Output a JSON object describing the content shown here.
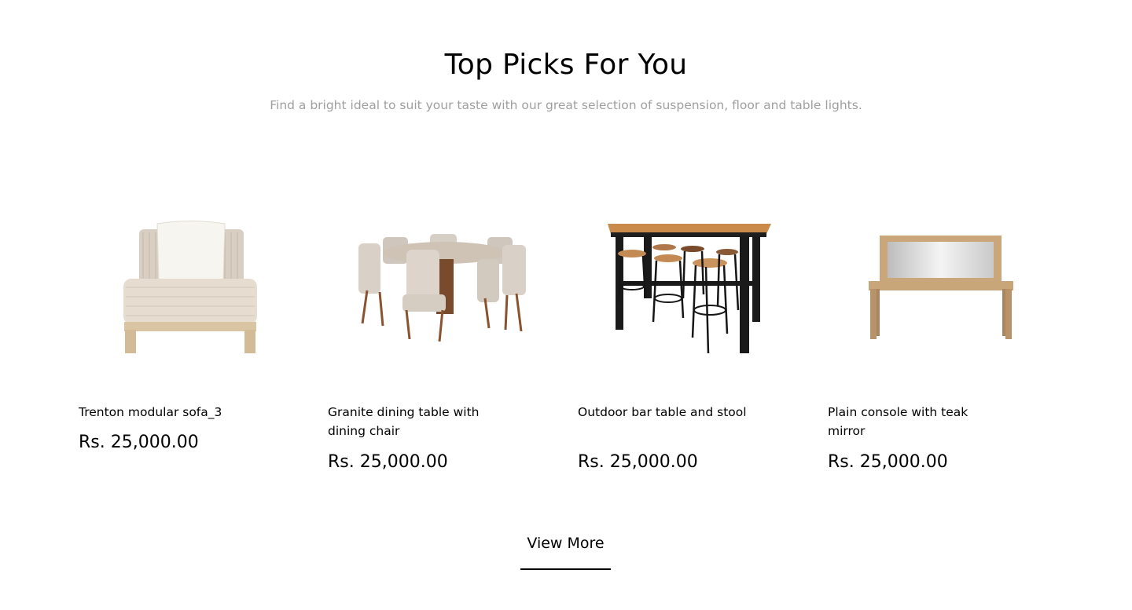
{
  "section": {
    "title": "Top Picks For You",
    "subtitle": "Find a bright ideal to suit your taste with our great selection of suspension, floor and table lights."
  },
  "products": [
    {
      "name": "Trenton modular sofa_3",
      "price": "Rs. 25,000.00",
      "image_icon": "modular-sofa-image"
    },
    {
      "name": "Granite dining table with dining chair",
      "price": "Rs. 25,000.00",
      "image_icon": "dining-table-set-image"
    },
    {
      "name": "Outdoor bar table and stool",
      "price": "Rs. 25,000.00",
      "image_icon": "bar-table-stools-image"
    },
    {
      "name": "Plain console with teak mirror",
      "price": "Rs. 25,000.00",
      "image_icon": "console-mirror-image"
    }
  ],
  "view_more": {
    "label": "View More"
  },
  "colors": {
    "text": "#000000",
    "subtitle": "#9f9f9f",
    "background": "#ffffff"
  }
}
